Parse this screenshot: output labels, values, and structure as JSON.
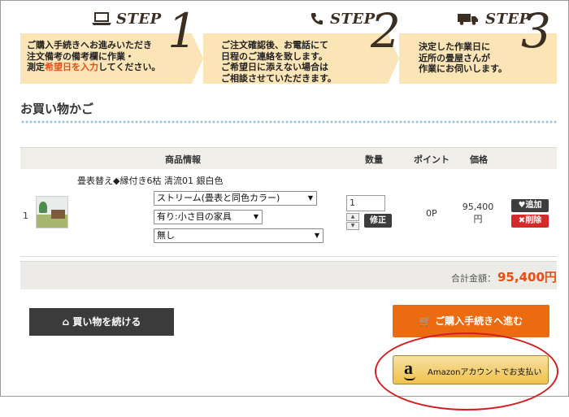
{
  "steps": [
    {
      "icon": "laptop-icon",
      "label": "STEP",
      "number": "1",
      "lines": [
        "ご購入手続きへお進みいただき",
        "注文備考の備考欄に作業・"
      ],
      "line3_before": "測定",
      "line3_highlight": "希望日を入力",
      "line3_after": "してください。"
    },
    {
      "icon": "phone-icon",
      "label": "STEP",
      "number": "2",
      "lines": [
        "ご注文確認後、お電話にて",
        "日程のご連絡を致します。",
        "ご希望日に添えない場合は",
        "ご相談させていただきます。"
      ]
    },
    {
      "icon": "truck-icon",
      "label": "STEP",
      "number": "3",
      "lines": [
        "決定した作業日に",
        "近所の畳屋さんが",
        "作業にお伺いします。"
      ]
    }
  ],
  "cart": {
    "title": "お買い物かご",
    "headers": {
      "product": "商品情報",
      "quantity": "数量",
      "points": "ポイント",
      "price": "価格"
    },
    "items": [
      {
        "index": "1",
        "name": "畳表替え◆縁付き6枯 清流01 銀白色",
        "options": [
          "ストリーム(畳表と同色カラー)",
          "有り:小さ目の家具",
          "無し"
        ],
        "quantity": "1",
        "fix_label": "修正",
        "points": "0P",
        "price_value": "95,400",
        "price_unit": "円",
        "add_label": "追加",
        "delete_label": "削除"
      }
    ],
    "total_label": "合計金額：",
    "total_value": "95,400円"
  },
  "buttons": {
    "continue": "買い物を続ける",
    "checkout": "ご購入手続きへ進む",
    "amazon_logo": "a",
    "amazon": "Amazonアカウントでお支払い"
  },
  "colors": {
    "step_bg": "#fbe4b6",
    "highlight": "#e64e12",
    "checkout": "#ec6a10",
    "delete": "#d52a2a",
    "annotation": "#d21f1f"
  }
}
